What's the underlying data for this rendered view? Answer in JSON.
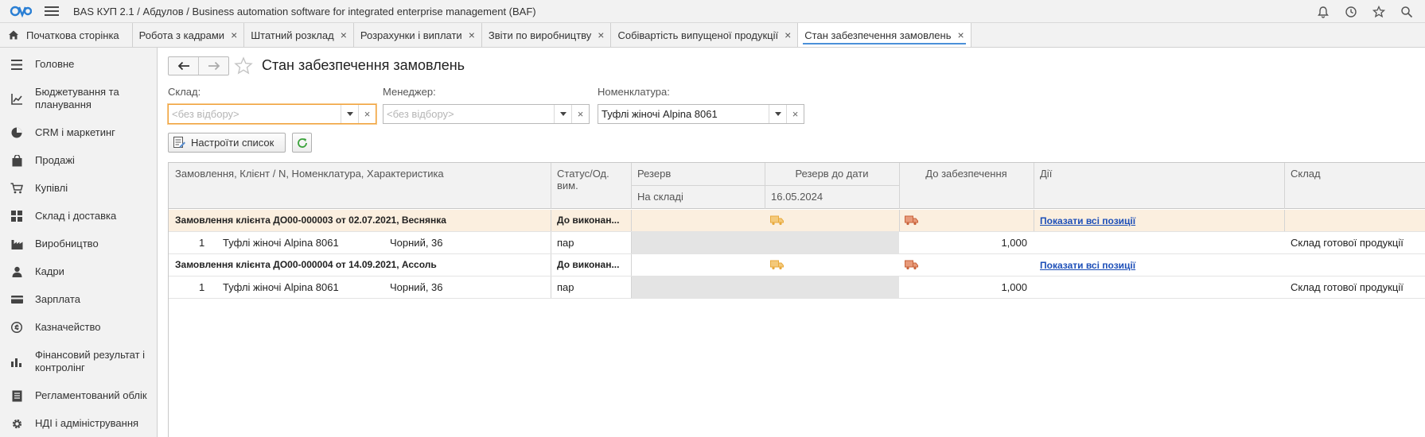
{
  "app": {
    "title": "BAS КУП 2.1 / Абдулов / Business automation software for integrated enterprise management  (BAF)"
  },
  "top_icons": [
    "bell-icon",
    "history-icon",
    "star-icon",
    "search-icon"
  ],
  "tabs": [
    {
      "label": "Початкова сторінка",
      "home": true
    },
    {
      "label": "Робота з кадрами",
      "closable": true
    },
    {
      "label": "Штатний розклад",
      "closable": true
    },
    {
      "label": "Розрахунки і виплати",
      "closable": true
    },
    {
      "label": "Звіти по виробництву",
      "closable": true
    },
    {
      "label": "Собівартість випущеної продукції",
      "closable": true
    },
    {
      "label": "Стан забезпечення замовлень",
      "closable": true,
      "active": true
    }
  ],
  "close_glyph": "×",
  "sidebar": {
    "items": [
      {
        "label": "Головне",
        "icon": "menu-list-icon"
      },
      {
        "label": "Бюджетування та планування",
        "icon": "chart-line-icon"
      },
      {
        "label": "CRM і маркетинг",
        "icon": "pie-chart-icon"
      },
      {
        "label": "Продажі",
        "icon": "shopping-bag-icon"
      },
      {
        "label": "Купівлі",
        "icon": "cart-icon"
      },
      {
        "label": "Склад і доставка",
        "icon": "warehouse-grid-icon"
      },
      {
        "label": "Виробництво",
        "icon": "factory-icon"
      },
      {
        "label": "Кадри",
        "icon": "person-icon"
      },
      {
        "label": "Зарплата",
        "icon": "wallet-icon"
      },
      {
        "label": "Казначейство",
        "icon": "coin-icon"
      },
      {
        "label": "Фінансовий результат і контролінг",
        "icon": "bar-chart-icon"
      },
      {
        "label": "Регламентований облік",
        "icon": "ledger-icon"
      },
      {
        "label": "НДІ і адміністрування",
        "icon": "gear-icon"
      }
    ]
  },
  "page": {
    "title": "Стан забезпечення замовлень"
  },
  "filters": {
    "warehouse": {
      "label": "Склад:",
      "value": "",
      "placeholder": "<без відбору>"
    },
    "manager": {
      "label": "Менеджер:",
      "value": "",
      "placeholder": "<без відбору>"
    },
    "nomenclature": {
      "label": "Номенклатура:",
      "value": "Туфлі жіночі Alpina 8061",
      "placeholder": ""
    }
  },
  "toolbar": {
    "settings_label": "Настроїти список"
  },
  "table": {
    "headers": {
      "order": "Замовлення, Клієнт / N, Номенклатура, Характеристика",
      "status": "Статус/Од. вим.",
      "reserve": "Резерв",
      "reserve_until": "Резерв до дати",
      "on_stock": "На складі",
      "reserve_date": "16.05.2024",
      "to_provide": "До забезпечення",
      "actions": "Дії",
      "warehouse": "Склад"
    },
    "rows": [
      {
        "type": "order",
        "highlight": true,
        "title": "Замовлення клієнта ДО00-000003 от 02.07.2021, Веснянка",
        "status": "До виконан...",
        "action": "Показати всі позиції"
      },
      {
        "type": "item",
        "n": "1",
        "nomenclature": "Туфлі жіночі Alpina 8061",
        "characteristic": "Чорний, 36",
        "unit": "пар",
        "to_provide": "1,000",
        "warehouse": "Склад готової продукції"
      },
      {
        "type": "order",
        "highlight": false,
        "title": "Замовлення клієнта ДО00-000004 от 14.09.2021, Ассоль",
        "status": "До виконан...",
        "action": "Показати всі позиції"
      },
      {
        "type": "item",
        "n": "1",
        "nomenclature": "Туфлі жіночі Alpina 8061",
        "characteristic": "Чорний, 36",
        "unit": "пар",
        "to_provide": "1,000",
        "warehouse": "Склад готової продукції"
      }
    ]
  },
  "colors": {
    "accent": "#4a90d9",
    "focus": "#f0a13a",
    "row_highlight": "#fbefdf",
    "link": "#1d4fb8",
    "refresh": "#3aa23a",
    "truck_yellow": "#e8a93c",
    "truck_red": "#c8623a"
  }
}
